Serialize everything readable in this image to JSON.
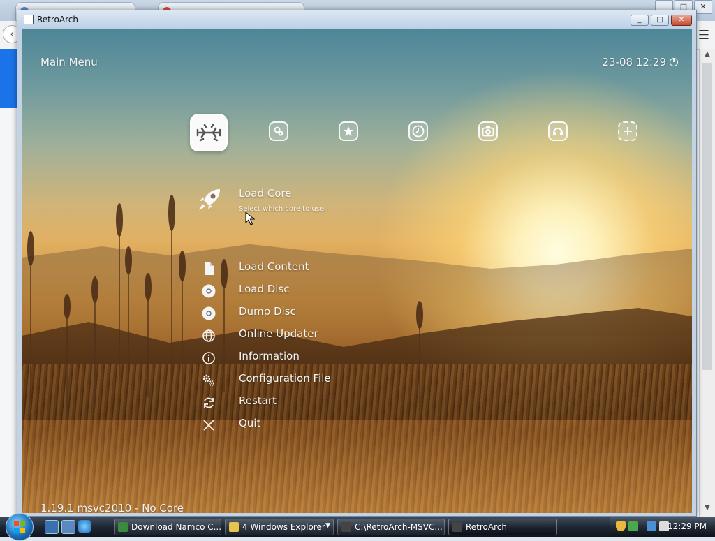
{
  "background_browser": {
    "window_controls": [
      "_",
      "□",
      "✕"
    ]
  },
  "window": {
    "title": "RetroArch",
    "min_label": "_",
    "max_label": "□",
    "close_label": "✕"
  },
  "retroarch": {
    "menu_title": "Main Menu",
    "datetime": "23-08 12:29",
    "tabs": [
      {
        "icon": "retroarch-invader-icon",
        "active": true
      },
      {
        "icon": "settings-gears-icon"
      },
      {
        "icon": "favorites-star-icon"
      },
      {
        "icon": "history-clock-icon"
      },
      {
        "icon": "images-camera-icon"
      },
      {
        "icon": "netplay-icon"
      },
      {
        "icon": "add-plus-icon"
      }
    ],
    "selected_item": {
      "label": "Load Core",
      "sublabel": "Select which core to use.",
      "icon": "rocket-icon"
    },
    "items": [
      {
        "label": "Load Content",
        "icon": "file-icon"
      },
      {
        "label": "Load Disc",
        "icon": "disc-icon"
      },
      {
        "label": "Dump Disc",
        "icon": "disc-icon"
      },
      {
        "label": "Online Updater",
        "icon": "globe-icon"
      },
      {
        "label": "Information",
        "icon": "info-icon"
      },
      {
        "label": "Configuration File",
        "icon": "config-gears-icon"
      },
      {
        "label": "Restart",
        "icon": "restart-icon"
      },
      {
        "label": "Quit",
        "icon": "close-x-icon"
      }
    ],
    "version": "1.19.1 msvc2010 - No Core"
  },
  "taskbar": {
    "items": [
      {
        "label": "Download Namco C...",
        "icon": "browser-icon",
        "color": "#3b8a3e"
      },
      {
        "label": "4 Windows Explorer",
        "icon": "folder-icon",
        "color": "#e6c34a"
      },
      {
        "label": "C:\\RetroArch-MSVC...",
        "icon": "retroarch-icon",
        "color": "#444444"
      },
      {
        "label": "RetroArch",
        "icon": "retroarch-icon",
        "color": "#444444"
      }
    ],
    "clock": "12:29 PM"
  },
  "colors": {
    "menu_text": "#f4f4f4",
    "titlebar": "#c3d3e3",
    "close_button": "#c44b32"
  }
}
